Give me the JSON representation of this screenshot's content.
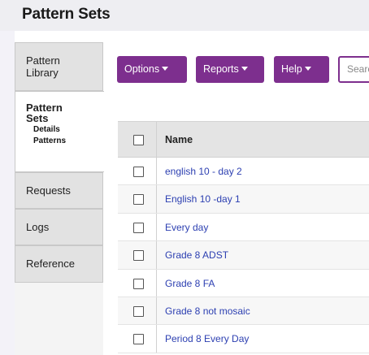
{
  "header": {
    "title": "Pattern Sets"
  },
  "sidebar": {
    "items": [
      {
        "label": "Pattern\nLibrary"
      },
      {
        "label": "Pattern\nSets",
        "active": true,
        "sub": [
          "Details",
          "Patterns"
        ]
      },
      {
        "label": "Requests"
      },
      {
        "label": "Logs"
      },
      {
        "label": "Reference"
      }
    ]
  },
  "toolbar": {
    "options_label": "Options",
    "reports_label": "Reports",
    "help_label": "Help",
    "search_placeholder": "Search",
    "accent_color": "#7d2f8e"
  },
  "table": {
    "header_name": "Name",
    "rows": [
      "english 10 - day 2",
      "English 10 -day 1",
      "Every day",
      "Grade 8 ADST",
      "Grade 8 FA",
      "Grade 8 not mosaic",
      "Period 8 Every Day"
    ],
    "link_color": "#2c3fb1"
  }
}
